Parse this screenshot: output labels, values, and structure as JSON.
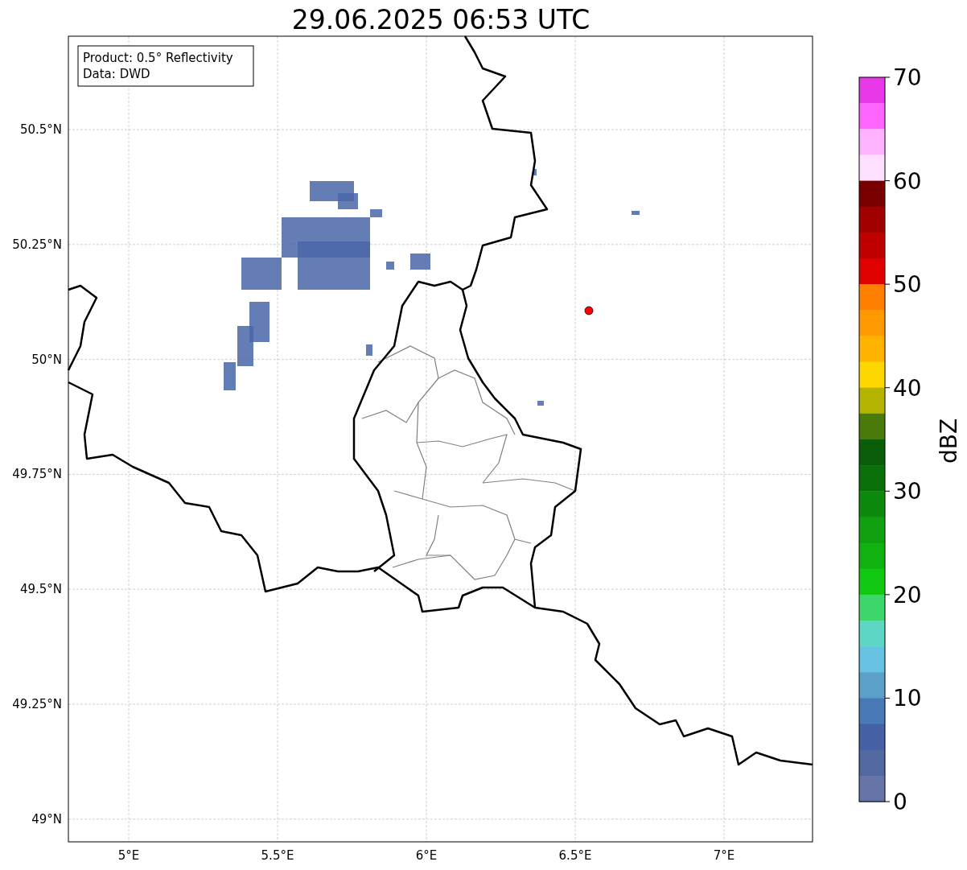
{
  "title": "29.06.2025 06:53 UTC",
  "info_box": [
    "Product: 0.5° Reflectivity",
    "Data: DWD"
  ],
  "lat_labels": [
    "50.5°N",
    "50.25°N",
    "50°N",
    "49.75°N",
    "49.5°N",
    "49.25°N",
    "49°N"
  ],
  "lon_labels": [
    "5°E",
    "5.5°E",
    "6°E",
    "6.5°E",
    "7°E"
  ],
  "colorbar": {
    "label": "dBZ",
    "ticks": [
      "70",
      "60",
      "50",
      "40",
      "30",
      "20",
      "10",
      "0"
    ],
    "bands": [
      {
        "color": "#e838e8"
      },
      {
        "color": "#ff66ff"
      },
      {
        "color": "#ffb3ff"
      },
      {
        "color": "#ffe0ff"
      },
      {
        "color": "#7a0000"
      },
      {
        "color": "#a00000"
      },
      {
        "color": "#c00000"
      },
      {
        "color": "#e00000"
      },
      {
        "color": "#ff7f00"
      },
      {
        "color": "#ff9900"
      },
      {
        "color": "#ffb300"
      },
      {
        "color": "#ffd700"
      },
      {
        "color": "#b3b300"
      },
      {
        "color": "#4a7a0a"
      },
      {
        "color": "#0a5e0a"
      },
      {
        "color": "#0a700a"
      },
      {
        "color": "#0d8a0d"
      },
      {
        "color": "#0f9f0f"
      },
      {
        "color": "#0fb20f"
      },
      {
        "color": "#12c912"
      },
      {
        "color": "#3dd66b"
      },
      {
        "color": "#5ed6c6"
      },
      {
        "color": "#66c2e0"
      },
      {
        "color": "#5aa0c8"
      },
      {
        "color": "#4a7ab5"
      },
      {
        "color": "#4560a4"
      },
      {
        "color": "#5268a0"
      },
      {
        "color": "#6674a8"
      }
    ]
  }
}
